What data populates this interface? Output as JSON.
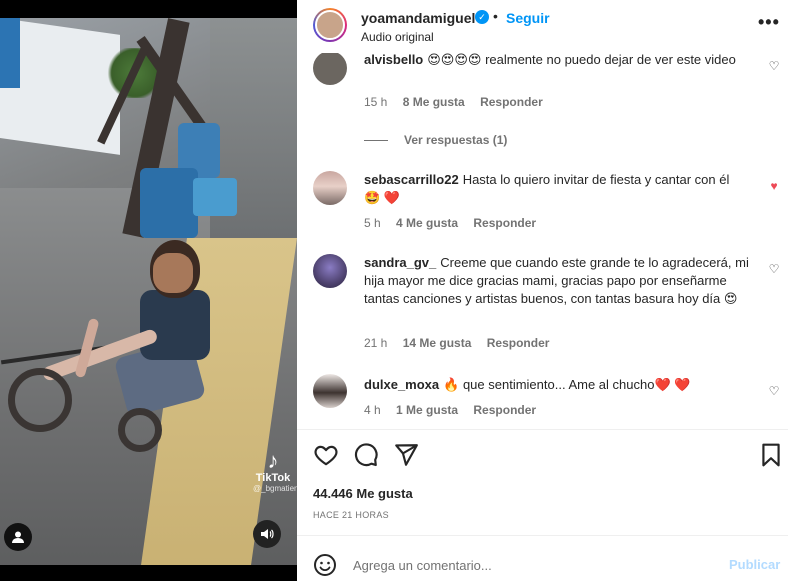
{
  "post": {
    "username": "yoamandamiguel",
    "follow_label": "Seguir",
    "dot": "•",
    "audio": "Audio original",
    "more_label": "•••"
  },
  "media": {
    "tiktok_word": "TikTok",
    "tiktok_handle": "@_bgmatien"
  },
  "comments": [
    {
      "user": "alvisbello",
      "text": "😍😍😍😍 realmente no puedo dejar de ver este video",
      "time": "15 h",
      "likes": "8 Me gusta",
      "reply": "Responder",
      "liked": false,
      "view_replies": "Ver respuestas (1)"
    },
    {
      "user": "sebascarrillo22",
      "text": "Hasta lo quiero invitar de fiesta y cantar con él 🤩 ❤️",
      "time": "5 h",
      "likes": "4 Me gusta",
      "reply": "Responder",
      "liked": true
    },
    {
      "user": "sandra_gv_",
      "text": "Creeme que cuando este grande te lo agradecerá, mi hija mayor me dice gracias mami, gracias papo por enseñarme tantas canciones y artistas buenos, con tantas basura hoy día 😍",
      "time": "21 h",
      "likes": "14 Me gusta",
      "reply": "Responder",
      "liked": false
    },
    {
      "user": "dulxe_moxa",
      "text": "🔥 que sentimiento... Ame al chucho❤️ ❤️",
      "time": "4 h",
      "likes": "1 Me gusta",
      "reply": "Responder",
      "liked": false
    }
  ],
  "footer": {
    "likes_count": "44.446 Me gusta",
    "time_ago": "HACE 21 HORAS",
    "comment_placeholder": "Agrega un comentario...",
    "publish_label": "Publicar"
  },
  "colors": {
    "accent": "#0095f6",
    "like_red": "#ed4956",
    "muted": "#737373"
  }
}
